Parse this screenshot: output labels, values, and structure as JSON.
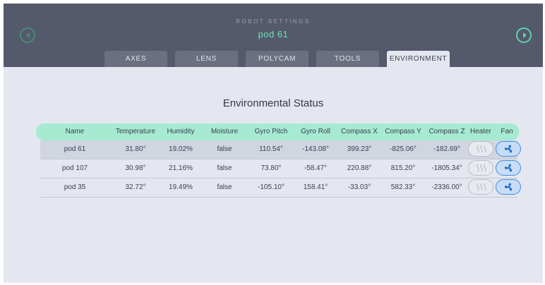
{
  "header": {
    "app_title": "ROBOT SETTINGS",
    "robot_name": "pod 61",
    "nav_left_icon": "chevron-left-icon",
    "nav_right_icon": "chevron-right-icon",
    "accent_color": "#6ee2b3"
  },
  "tabs": [
    {
      "label": "AXES",
      "active": false
    },
    {
      "label": "LENS",
      "active": false
    },
    {
      "label": "POLYCAM",
      "active": false
    },
    {
      "label": "TOOLS",
      "active": false
    },
    {
      "label": "ENVIRONMENT",
      "active": true
    }
  ],
  "main": {
    "section_title": "Environmental Status",
    "columns": [
      "Name",
      "Temperature",
      "Humidity",
      "Moisture",
      "Gyro Pitch",
      "Gyro Roll",
      "Compass X",
      "Compass Y",
      "Compass Z",
      "Heater",
      "Fan"
    ],
    "rows": [
      {
        "name": "pod 61",
        "temperature": "31.80°",
        "humidity": "19.02%",
        "moisture": "false",
        "gyro_pitch": "110.54°",
        "gyro_roll": "-143.08°",
        "compass_x": "399.23°",
        "compass_y": "-825.06°",
        "compass_z": "-182.69°",
        "heater_icon": "heat-waves-icon",
        "heater_on": false,
        "fan_icon": "fan-icon",
        "fan_on": true,
        "selected": true
      },
      {
        "name": "pod 107",
        "temperature": "30.98°",
        "humidity": "21.16%",
        "moisture": "false",
        "gyro_pitch": "73.80°",
        "gyro_roll": "-58.47°",
        "compass_x": "220.88°",
        "compass_y": "815.20°",
        "compass_z": "-1805.34°",
        "heater_icon": "heat-waves-icon",
        "heater_on": false,
        "fan_icon": "fan-icon",
        "fan_on": true,
        "selected": false
      },
      {
        "name": "pod 35",
        "temperature": "32.72°",
        "humidity": "19.49%",
        "moisture": "false",
        "gyro_pitch": "-105.10°",
        "gyro_roll": "158.41°",
        "compass_x": "-33.03°",
        "compass_y": "582.33°",
        "compass_z": "-2336.00°",
        "heater_icon": "heat-waves-icon",
        "heater_on": false,
        "fan_icon": "fan-icon",
        "fan_on": true,
        "selected": false
      }
    ]
  }
}
